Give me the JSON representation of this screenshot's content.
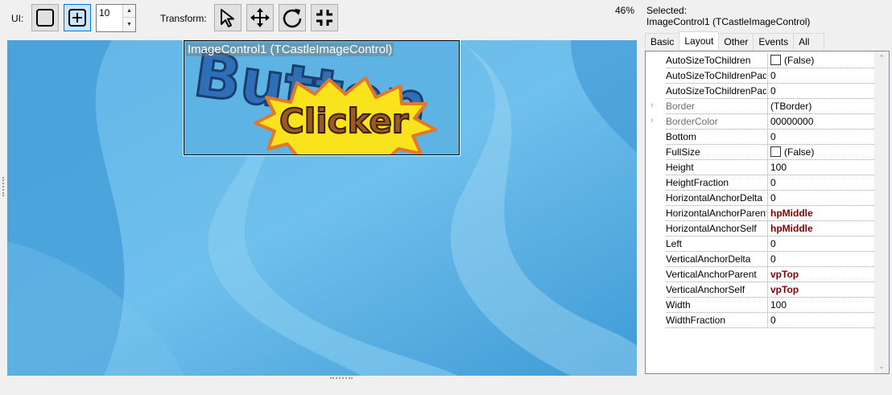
{
  "toolbar": {
    "ui_label": "UI:",
    "spin_value": "10",
    "transform_label": "Transform:",
    "zoom": "46%"
  },
  "viewport": {
    "control_label": "ImageControl1 (TCastleImageControl)",
    "image_text_top": "Button",
    "image_text_bottom": "Clicker"
  },
  "selection": {
    "label": "Selected:",
    "value": "ImageControl1 (TCastleImageControl)"
  },
  "tabs": [
    "Basic",
    "Layout",
    "Other",
    "Events",
    "All"
  ],
  "properties": [
    {
      "name": "AutoSizeToChildren",
      "value": "(False)",
      "checkbox": true
    },
    {
      "name": "AutoSizeToChildrenPaddingBottom",
      "value": "0"
    },
    {
      "name": "AutoSizeToChildrenPaddingRight",
      "value": "0"
    },
    {
      "name": "Border",
      "value": "(TBorder)",
      "expandable": true
    },
    {
      "name": "BorderColor",
      "value": "00000000",
      "expandable": true
    },
    {
      "name": "Bottom",
      "value": "0"
    },
    {
      "name": "FullSize",
      "value": "(False)",
      "checkbox": true
    },
    {
      "name": "Height",
      "value": "100"
    },
    {
      "name": "HeightFraction",
      "value": "0"
    },
    {
      "name": "HorizontalAnchorDelta",
      "value": "0"
    },
    {
      "name": "HorizontalAnchorParent",
      "value": "hpMiddle",
      "bold": true
    },
    {
      "name": "HorizontalAnchorSelf",
      "value": "hpMiddle",
      "bold": true
    },
    {
      "name": "Left",
      "value": "0"
    },
    {
      "name": "VerticalAnchorDelta",
      "value": "0"
    },
    {
      "name": "VerticalAnchorParent",
      "value": "vpTop",
      "bold": true
    },
    {
      "name": "VerticalAnchorSelf",
      "value": "vpTop",
      "bold": true
    },
    {
      "name": "Width",
      "value": "100"
    },
    {
      "name": "WidthFraction",
      "value": "0"
    }
  ],
  "colors": {
    "accent": "#0078d7",
    "bold_value": "#800000",
    "viewport_bg": "#4aa4da"
  },
  "icons": [
    "rectangle-icon",
    "add-control-icon",
    "cursor-arrow-icon",
    "move-icon",
    "rotate-icon",
    "resize-icon",
    "expand-chevron-icon"
  ]
}
